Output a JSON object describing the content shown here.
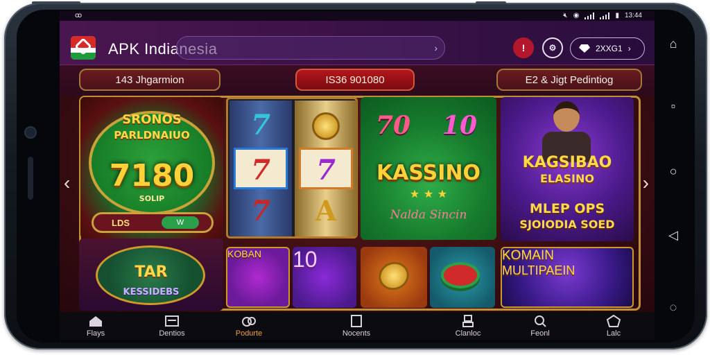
{
  "status_bar": {
    "left_text": "ꝏ",
    "time": "13:44"
  },
  "app_bar": {
    "title": "APK Indianesia",
    "search_placeholder": "",
    "account_label": "2XXG1"
  },
  "info_bar": {
    "jackpot": "143 Jhgarmion",
    "total": "IS36 901080",
    "pending": "E2 & Jigt Pedintiog"
  },
  "tiles": {
    "t1": {
      "title1": "SRONOS",
      "title2": "PARLDNAIUO",
      "amount": "7180",
      "sub": "SOLIP",
      "bar_a": "LDS",
      "bar_b": "W"
    },
    "t2": {
      "title1": "TAR",
      "title2": "KESSIDEBS"
    },
    "reels": {
      "s1": "7",
      "s2": "7",
      "s3": "7",
      "s5": "7",
      "s6": "A"
    },
    "t3": {
      "n1": "70",
      "n2": "10",
      "title": "KASSINO",
      "stars": "★ ★ ★",
      "script": "Nalda Sincin"
    },
    "t4": {
      "title1": "KAGSIBAO",
      "title2": "ELASINO",
      "line3": "MLEP OPS",
      "line4": "SJOIODIA SOED"
    },
    "kob": {
      "label": "KOBAN"
    },
    "ten": {
      "label": "10"
    },
    "multi": {
      "title1": "KOMAIN",
      "title2": "MULTIPAEIN"
    }
  },
  "bottom_nav": [
    {
      "label": "Flays"
    },
    {
      "label": "Dentios"
    },
    {
      "label": "Podurte"
    },
    {
      "label": "Nocents"
    },
    {
      "label": "Clanloc"
    },
    {
      "label": "Feonl"
    },
    {
      "label": "Lalc"
    }
  ],
  "colors": {
    "accent": "#f0a040",
    "frame_gold": "#c09036",
    "bell_red": "#b3172c"
  }
}
